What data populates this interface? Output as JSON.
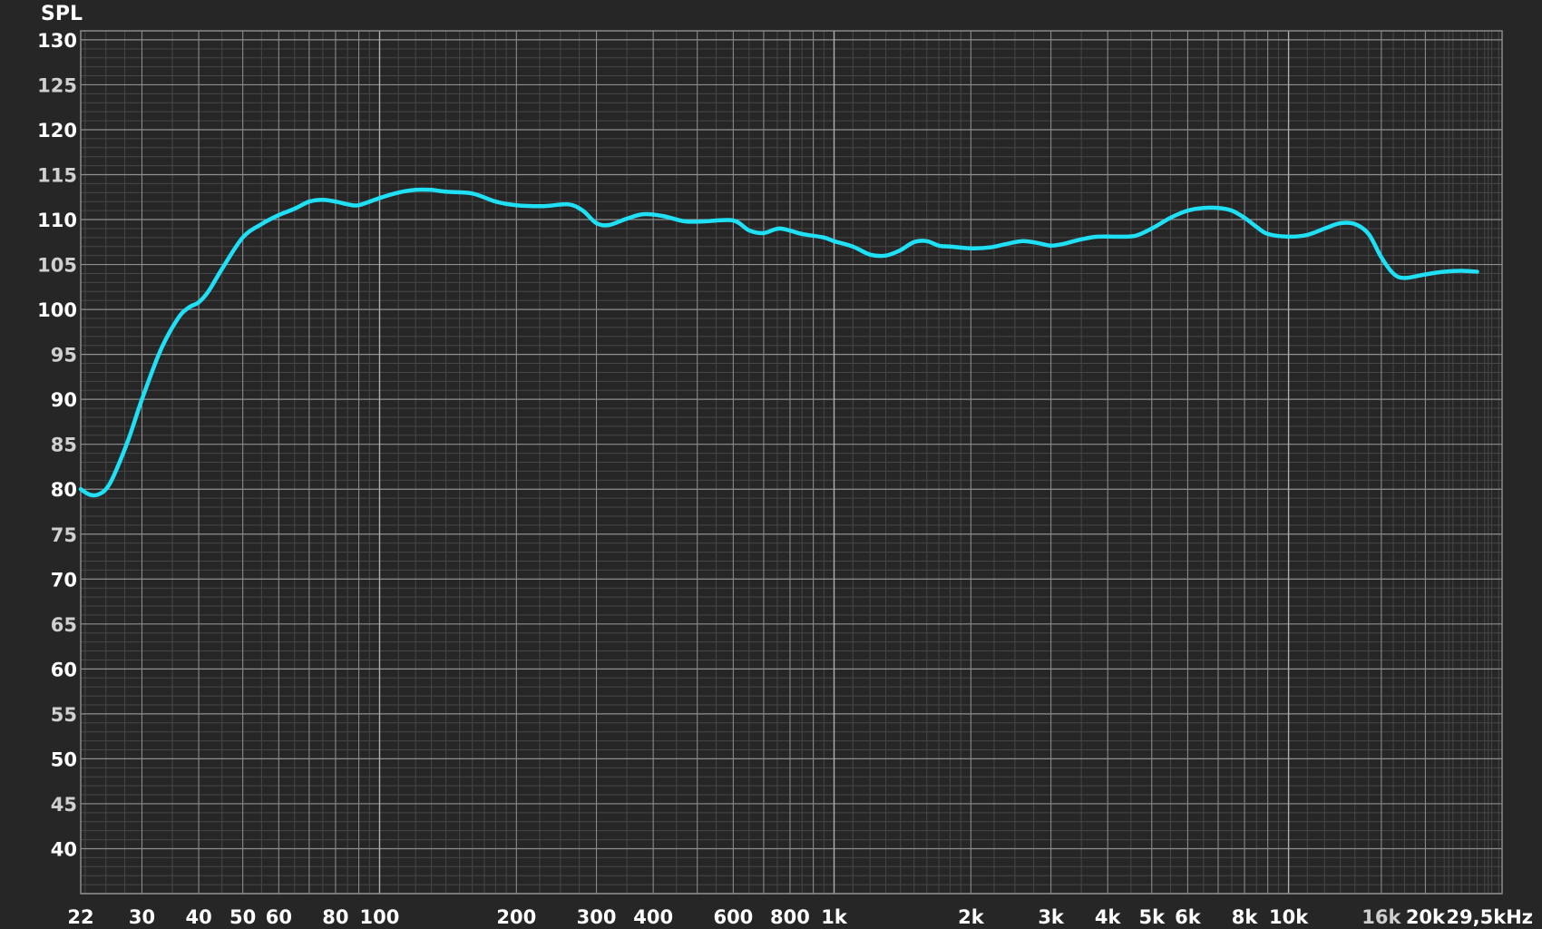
{
  "chart_data": {
    "type": "line",
    "ylabel": "SPL",
    "x_scale": "log",
    "xlim": [
      22,
      29500
    ],
    "ylim": [
      35,
      131
    ],
    "grid": true,
    "x_ticks": [
      {
        "value": 22,
        "label": "22"
      },
      {
        "value": 30,
        "label": "30"
      },
      {
        "value": 40,
        "label": "40"
      },
      {
        "value": 50,
        "label": "50"
      },
      {
        "value": 60,
        "label": "60"
      },
      {
        "value": 80,
        "label": "80"
      },
      {
        "value": 100,
        "label": "100"
      },
      {
        "value": 200,
        "label": "200"
      },
      {
        "value": 300,
        "label": "300"
      },
      {
        "value": 400,
        "label": "400"
      },
      {
        "value": 600,
        "label": "600"
      },
      {
        "value": 800,
        "label": "800"
      },
      {
        "value": 1000,
        "label": "1k"
      },
      {
        "value": 2000,
        "label": "2k"
      },
      {
        "value": 3000,
        "label": "3k"
      },
      {
        "value": 4000,
        "label": "4k"
      },
      {
        "value": 5000,
        "label": "5k"
      },
      {
        "value": 6000,
        "label": "6k"
      },
      {
        "value": 8000,
        "label": "8k"
      },
      {
        "value": 10000,
        "label": "10k"
      },
      {
        "value": 16000,
        "label": "16k"
      },
      {
        "value": 20000,
        "label": "20k"
      },
      {
        "value": 29500,
        "label": "29,5kHz"
      }
    ],
    "y_ticks": [
      130,
      125,
      120,
      115,
      110,
      105,
      100,
      95,
      90,
      85,
      80,
      75,
      70,
      65,
      60,
      55,
      50,
      45,
      40
    ],
    "series": [
      {
        "color": "#1fe0f5",
        "x": [
          22,
          23,
          24,
          25,
          26,
          28,
          30,
          33,
          36,
          38,
          40,
          42,
          45,
          50,
          55,
          60,
          65,
          70,
          75,
          80,
          85,
          90,
          100,
          110,
          120,
          130,
          140,
          160,
          180,
          200,
          230,
          260,
          280,
          300,
          320,
          350,
          380,
          420,
          470,
          520,
          600,
          650,
          700,
          760,
          850,
          950,
          1000,
          1100,
          1200,
          1300,
          1400,
          1500,
          1600,
          1700,
          1800,
          2000,
          2200,
          2400,
          2600,
          2800,
          3000,
          3200,
          3500,
          3800,
          4200,
          4600,
          5000,
          5500,
          6000,
          6500,
          7000,
          7500,
          8000,
          8500,
          9000,
          10000,
          11000,
          12000,
          13000,
          14000,
          15000,
          16000,
          17000,
          18000,
          20000,
          22000,
          24000,
          26000
        ],
        "y": [
          80,
          79.4,
          79.4,
          80,
          81.5,
          85.5,
          90,
          95.5,
          99,
          100.2,
          100.8,
          102,
          104.5,
          108,
          109.5,
          110.5,
          111.2,
          112,
          112.2,
          112,
          111.7,
          111.6,
          112.4,
          113,
          113.3,
          113.3,
          113.1,
          112.9,
          112,
          111.6,
          111.5,
          111.7,
          111,
          109.6,
          109.4,
          110.1,
          110.6,
          110.4,
          109.8,
          109.8,
          109.9,
          108.8,
          108.5,
          109,
          108.4,
          108,
          107.6,
          107,
          106.1,
          106,
          106.6,
          107.5,
          107.6,
          107.1,
          107,
          106.8,
          106.9,
          107.3,
          107.6,
          107.4,
          107.1,
          107.3,
          107.8,
          108.1,
          108.1,
          108.2,
          109,
          110.2,
          111,
          111.3,
          111.3,
          111,
          110.2,
          109.2,
          108.4,
          108.1,
          108.3,
          109,
          109.6,
          109.5,
          108.4,
          105.8,
          104,
          103.5,
          103.9,
          104.2,
          104.3,
          104.2
        ]
      }
    ]
  }
}
